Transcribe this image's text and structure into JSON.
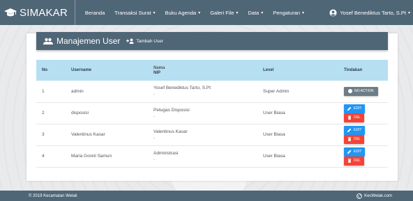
{
  "app": {
    "name": "SIMAKAR"
  },
  "nav": {
    "items": [
      {
        "label": "Beranda",
        "caret": ""
      },
      {
        "label": "Transaksi Surat",
        "caret": "▾"
      },
      {
        "label": "Buku Agenda",
        "caret": "▾"
      },
      {
        "label": "Galeri File",
        "caret": "▾"
      },
      {
        "label": "Data",
        "caret": "▾"
      },
      {
        "label": "Pengaturan",
        "caret": "▾"
      }
    ],
    "user": "Yosef Benediktus Tarto, S.Pt",
    "user_caret": "▾"
  },
  "page": {
    "title": "Manajemen User",
    "add_label": "Tambah User"
  },
  "table": {
    "headers": {
      "no": "No",
      "username": "Username",
      "nama": "Nama",
      "nip": "NIP",
      "level": "Level",
      "tindakan": "Tindakan"
    },
    "rows": [
      {
        "no": "1",
        "username": "admin",
        "nama": "Yosef Benediktus Tarto, S.Pt",
        "nip": "-",
        "level": "Super Admin",
        "action": "noaction"
      },
      {
        "no": "2",
        "username": "disposisi",
        "nama": "Petugas Disposisi",
        "nip": "-",
        "level": "User Biasa",
        "action": "editdel"
      },
      {
        "no": "3",
        "username": "Valentinus Kasar",
        "nama": "Valentinus Kasar",
        "nip": "-",
        "level": "User Biasa",
        "action": "editdel"
      },
      {
        "no": "4",
        "username": "Maria Goreti Samun",
        "nama": "Administrasi",
        "nip": "-",
        "level": "User Biasa",
        "action": "editdel"
      }
    ],
    "labels": {
      "edit": "EDIT",
      "del": "DEL",
      "noaction": "NO ACTION"
    }
  },
  "footer": {
    "left": "© 2019 Kecamatan Welak",
    "right": "KecWelak.com"
  },
  "colors": {
    "primary": "#4f6677",
    "header_row": "#b6dff2",
    "edit": "#2196f3",
    "del": "#f44336",
    "noaction": "#6c7d88"
  }
}
